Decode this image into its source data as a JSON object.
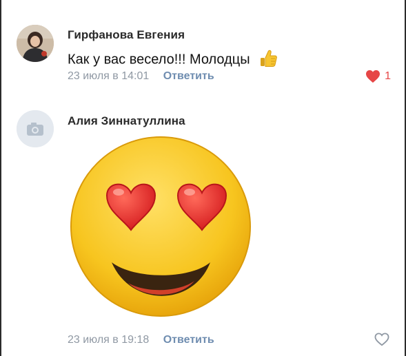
{
  "comments": [
    {
      "author": "Гирфанова Евгения",
      "text": "Как у вас весело!!! Молодцы",
      "time": "23 июля в 14:01",
      "reply_label": "Ответить",
      "likes": "1",
      "liked": true
    },
    {
      "author": "Алия Зиннатуллина",
      "sticker": "heart-eyes-smiley",
      "time": "23 июля в 19:18",
      "reply_label": "Ответить",
      "liked": false
    }
  ],
  "colors": {
    "reply": "#6f8db0",
    "meta": "#8f98a3",
    "like": "#e64646",
    "sticker_face": "#f5c524",
    "sticker_heart": "#e8292b"
  }
}
